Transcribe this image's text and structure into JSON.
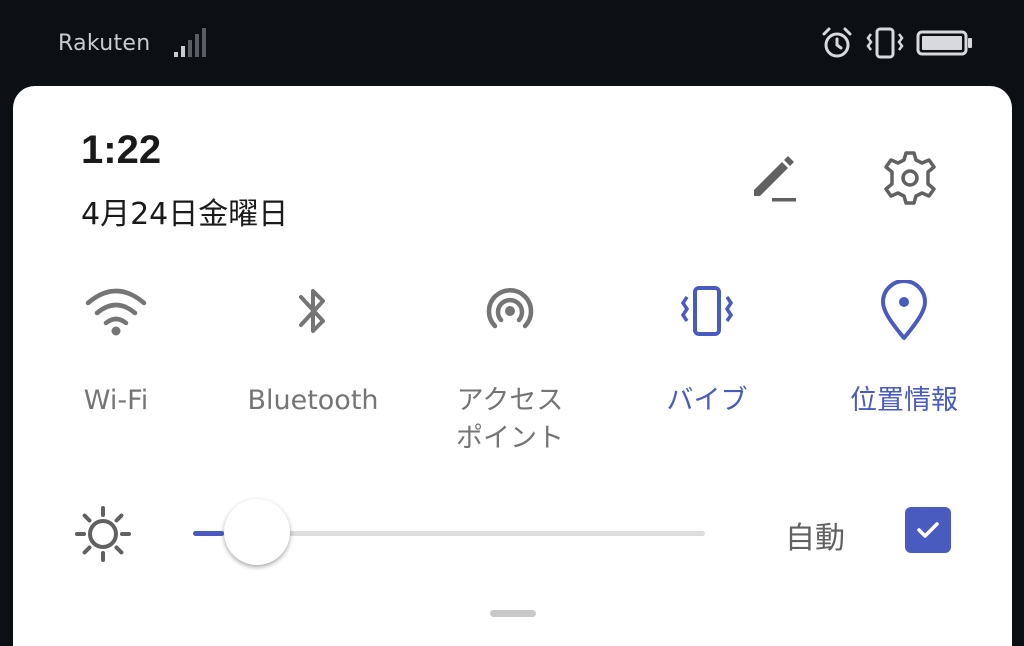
{
  "status_bar": {
    "carrier": "Rakuten",
    "icons": [
      "signal-icon",
      "alarm-icon",
      "vibrate-icon",
      "battery-icon"
    ]
  },
  "header": {
    "time": "1:22",
    "date": "4月24日金曜日",
    "actions": [
      "edit-icon",
      "settings-icon"
    ]
  },
  "tiles": [
    {
      "id": "wifi",
      "label": "Wi-Fi",
      "icon": "wifi-icon",
      "active": false
    },
    {
      "id": "bluetooth",
      "label": "Bluetooth",
      "icon": "bluetooth-icon",
      "active": false
    },
    {
      "id": "hotspot",
      "label": "アクセス\nポイント",
      "icon": "hotspot-icon",
      "active": false
    },
    {
      "id": "vibrate",
      "label": "バイブ",
      "icon": "vibrate-icon",
      "active": true
    },
    {
      "id": "location",
      "label": "位置情報",
      "icon": "location-icon",
      "active": true
    }
  ],
  "brightness": {
    "level": 0.06,
    "auto_label": "自動",
    "auto_checked": true
  },
  "colors": {
    "accent": "#4a5bbf",
    "inactive": "#757575",
    "panel": "#ffffff",
    "background": "#0c0f14"
  }
}
